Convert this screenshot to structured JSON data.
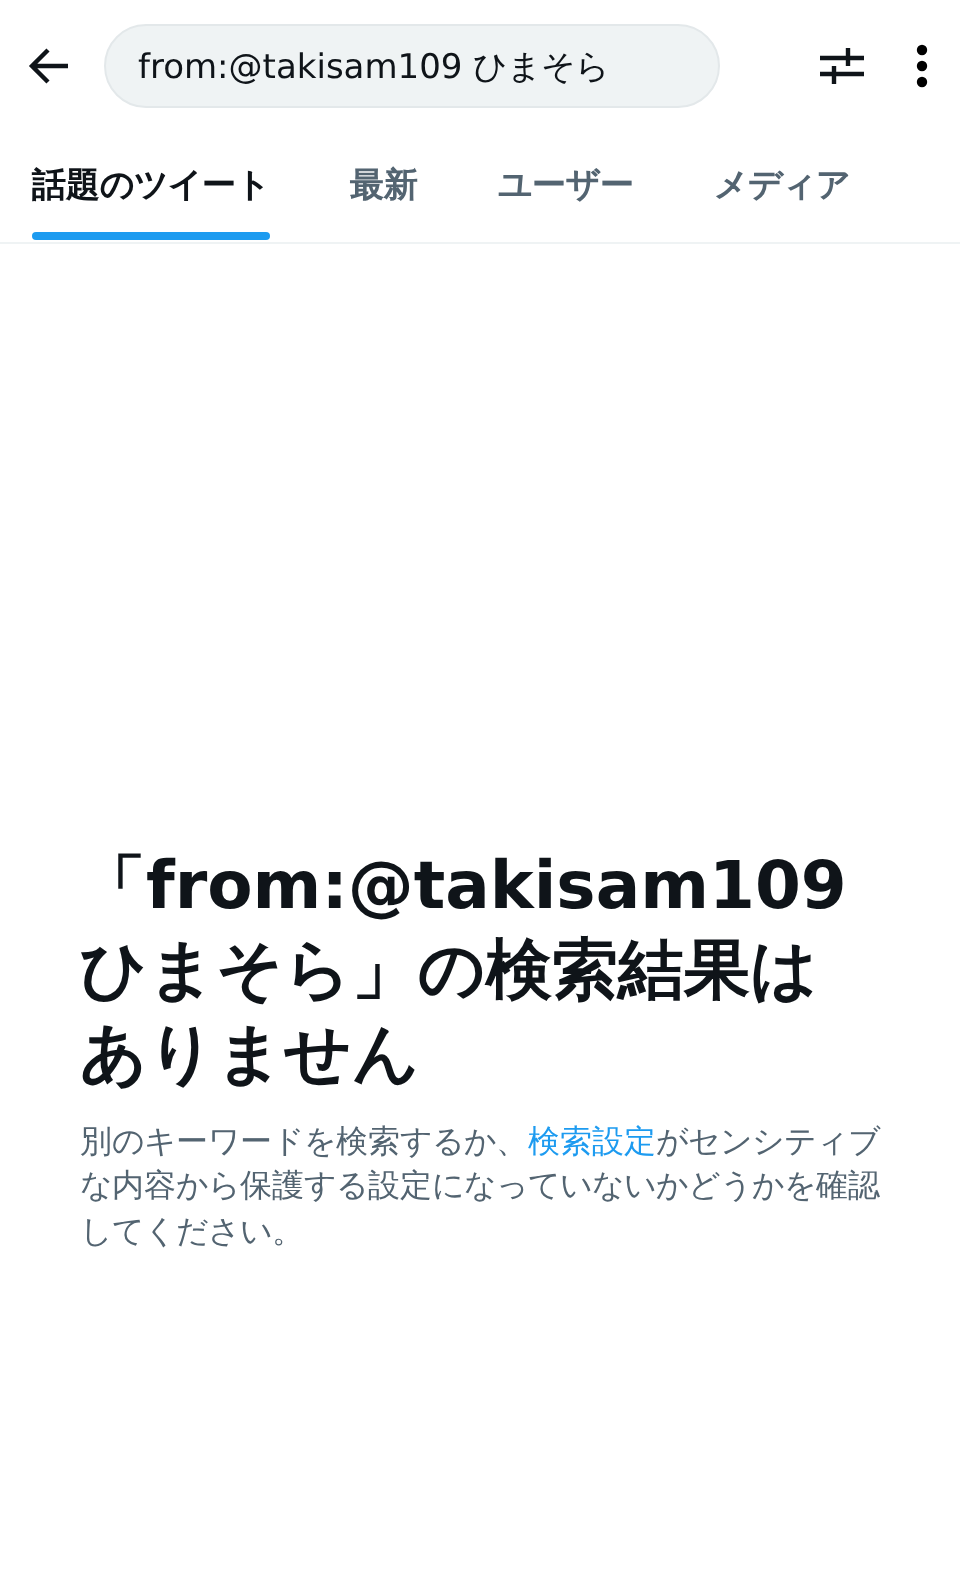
{
  "search": {
    "value": "from:@takisam109 ひまそら"
  },
  "tabs": [
    {
      "label": "話題のツイート",
      "selected": true
    },
    {
      "label": "最新",
      "selected": false
    },
    {
      "label": "ユーザー",
      "selected": false
    },
    {
      "label": "メディア",
      "selected": false
    }
  ],
  "empty_state": {
    "title": "「from:@takisam109 ひまそら」の検索結果はありません",
    "message_before": "別のキーワードを検索するか、",
    "link": "検索設定",
    "message_after": "がセンシティブな内容から保護する設定になっていないかどうかを確認してください。"
  }
}
